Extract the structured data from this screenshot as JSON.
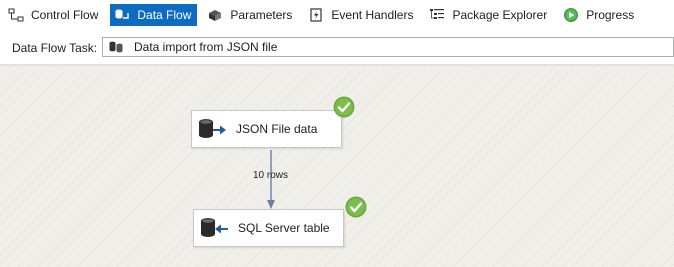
{
  "tabs": [
    {
      "label": "Control Flow",
      "icon": "control-flow-icon",
      "active": false
    },
    {
      "label": "Data Flow",
      "icon": "data-flow-icon",
      "active": true
    },
    {
      "label": "Parameters",
      "icon": "parameters-icon",
      "active": false
    },
    {
      "label": "Event Handlers",
      "icon": "event-handlers-icon",
      "active": false
    },
    {
      "label": "Package Explorer",
      "icon": "package-explorer-icon",
      "active": false
    },
    {
      "label": "Progress",
      "icon": "progress-icon",
      "active": false
    }
  ],
  "task": {
    "label": "Data Flow Task:",
    "value": "Data import from JSON file"
  },
  "components": {
    "source": {
      "label": "JSON File data",
      "status": "success"
    },
    "destination": {
      "label": "SQL Server table",
      "status": "success"
    }
  },
  "path": {
    "label": "10 rows"
  },
  "colors": {
    "active_tab": "#0e6bc2",
    "check_green": "#6aab3c",
    "path_line": "#6a7ea6",
    "canvas": "#f1efea"
  }
}
